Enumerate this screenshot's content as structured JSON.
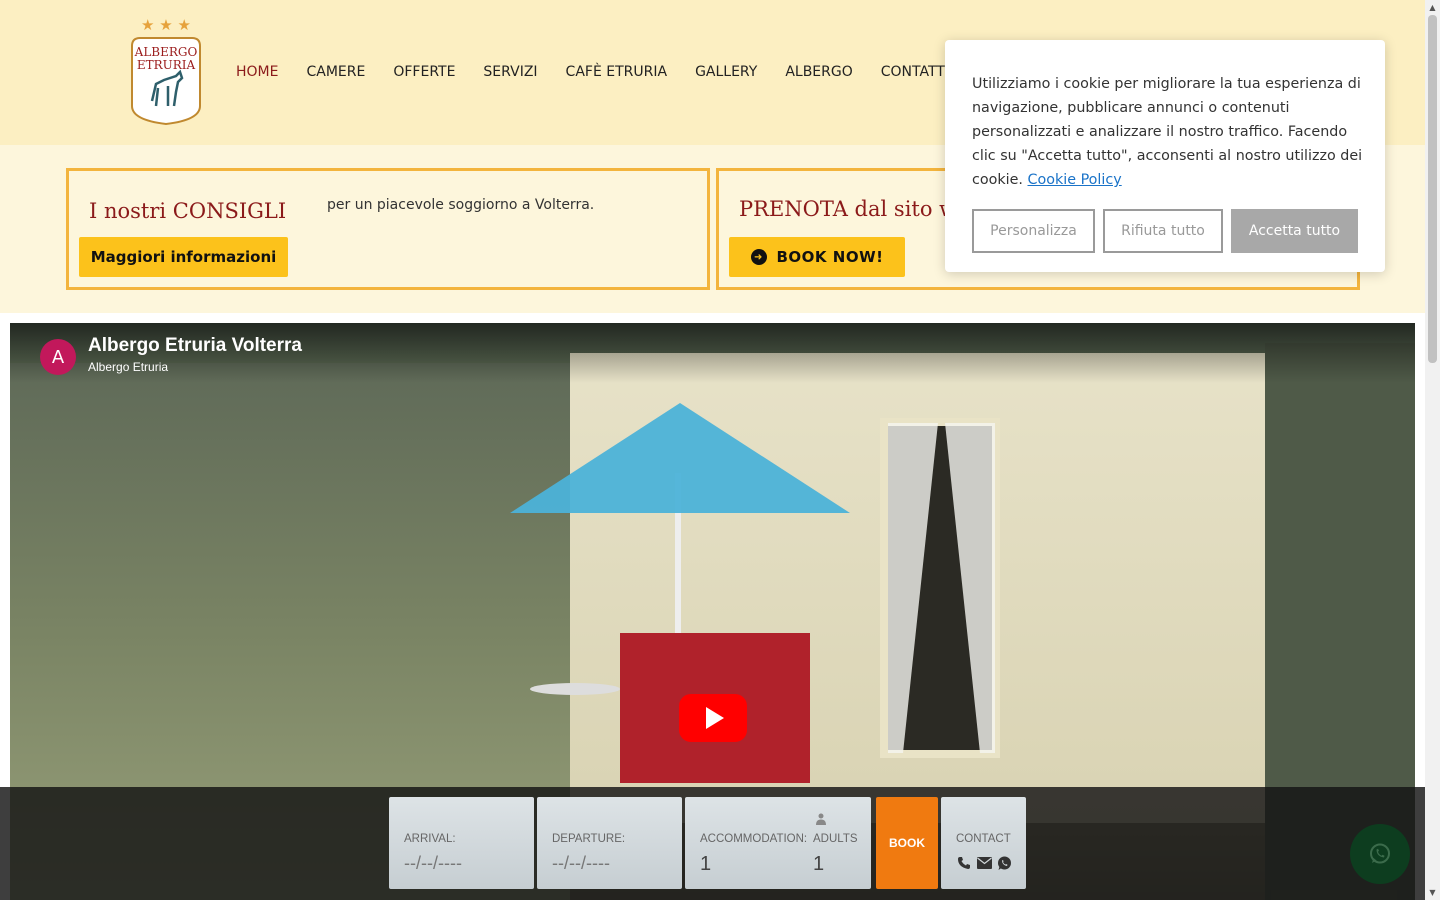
{
  "header": {
    "logo": {
      "line1": "ALBERGO",
      "line2": "ETRURIA",
      "stars": "★ ★ ★"
    },
    "nav": [
      {
        "label": "HOME",
        "active": true
      },
      {
        "label": "CAMERE"
      },
      {
        "label": "OFFERTE"
      },
      {
        "label": "SERVIZI"
      },
      {
        "label": "CAFÈ ETRURIA"
      },
      {
        "label": "GALLERY"
      },
      {
        "label": "ALBERGO"
      },
      {
        "label": "CONTATTI"
      }
    ]
  },
  "info": {
    "tips": {
      "title": "I nostri CONSIGLI",
      "subtitle": "per un piacevole soggiorno a Volterra.",
      "button": "Maggiori informazioni"
    },
    "booking": {
      "title": "PRENOTA dal sito web",
      "button": "BOOK NOW!"
    }
  },
  "video": {
    "channel_initial": "A",
    "title": "Albergo Etruria Volterra",
    "channel": "Albergo Etruria"
  },
  "booking_bar": {
    "arrival_label": "ARRIVAL:",
    "arrival_value": "--/--/----",
    "departure_label": "DEPARTURE:",
    "departure_value": "--/--/----",
    "accommodation_label": "ACCOMMODATION:",
    "accommodation_value": "1",
    "adults_label": "ADULTS",
    "adults_value": "1",
    "book_label": "BOOK",
    "contact_label": "CONTACT",
    "contact_icons": [
      "phone-icon",
      "mail-icon",
      "whatsapp-icon"
    ]
  },
  "cookie": {
    "text": "Utilizziamo i cookie per migliorare la tua esperienza di navigazione, pubblicare annunci o contenuti personalizzati e analizzare il nostro traffico. Facendo clic su \"Accetta tutto\", acconsenti al nostro utilizzo dei cookie.",
    "link": "Cookie Policy",
    "personalize": "Personalizza",
    "reject": "Rifiuta tutto",
    "accept": "Accetta tutto"
  },
  "colors": {
    "header_bg": "#fcefc2",
    "accent_red": "#8b1a1a",
    "yellow": "#fcc21b",
    "border_orange": "#f3b43d",
    "book_orange": "#f07a10"
  }
}
